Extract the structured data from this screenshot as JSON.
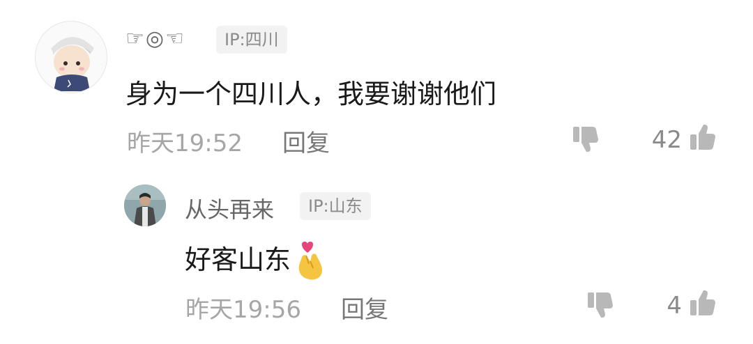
{
  "comment": {
    "username": "☞◎☜",
    "ip": "IP:四川",
    "text": "身为一个四川人，我要谢谢他们",
    "time": "昨天19:52",
    "reply_label": "回复",
    "like_count": "42"
  },
  "reply": {
    "username": "从头再来",
    "ip": "IP:山东",
    "text": "好客山东",
    "emoji": "heart-hands-emoji",
    "time": "昨天19:56",
    "reply_label": "回复",
    "like_count": "4"
  },
  "colors": {
    "text": "#1a1a1a",
    "meta": "#a6a6a6",
    "icon": "#b8b8b8",
    "ip_bg": "#f2f2f2"
  }
}
